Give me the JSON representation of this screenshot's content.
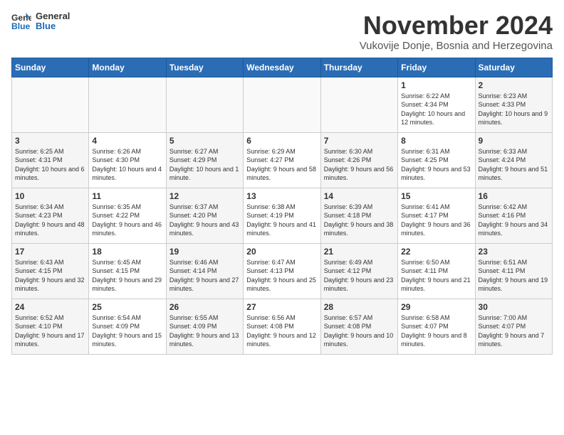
{
  "header": {
    "logo_line1": "General",
    "logo_line2": "Blue",
    "month_title": "November 2024",
    "subtitle": "Vukovije Donje, Bosnia and Herzegovina"
  },
  "weekdays": [
    "Sunday",
    "Monday",
    "Tuesday",
    "Wednesday",
    "Thursday",
    "Friday",
    "Saturday"
  ],
  "weeks": [
    [
      {
        "day": "",
        "text": ""
      },
      {
        "day": "",
        "text": ""
      },
      {
        "day": "",
        "text": ""
      },
      {
        "day": "",
        "text": ""
      },
      {
        "day": "",
        "text": ""
      },
      {
        "day": "1",
        "text": "Sunrise: 6:22 AM\nSunset: 4:34 PM\nDaylight: 10 hours and 12 minutes."
      },
      {
        "day": "2",
        "text": "Sunrise: 6:23 AM\nSunset: 4:33 PM\nDaylight: 10 hours and 9 minutes."
      }
    ],
    [
      {
        "day": "3",
        "text": "Sunrise: 6:25 AM\nSunset: 4:31 PM\nDaylight: 10 hours and 6 minutes."
      },
      {
        "day": "4",
        "text": "Sunrise: 6:26 AM\nSunset: 4:30 PM\nDaylight: 10 hours and 4 minutes."
      },
      {
        "day": "5",
        "text": "Sunrise: 6:27 AM\nSunset: 4:29 PM\nDaylight: 10 hours and 1 minute."
      },
      {
        "day": "6",
        "text": "Sunrise: 6:29 AM\nSunset: 4:27 PM\nDaylight: 9 hours and 58 minutes."
      },
      {
        "day": "7",
        "text": "Sunrise: 6:30 AM\nSunset: 4:26 PM\nDaylight: 9 hours and 56 minutes."
      },
      {
        "day": "8",
        "text": "Sunrise: 6:31 AM\nSunset: 4:25 PM\nDaylight: 9 hours and 53 minutes."
      },
      {
        "day": "9",
        "text": "Sunrise: 6:33 AM\nSunset: 4:24 PM\nDaylight: 9 hours and 51 minutes."
      }
    ],
    [
      {
        "day": "10",
        "text": "Sunrise: 6:34 AM\nSunset: 4:23 PM\nDaylight: 9 hours and 48 minutes."
      },
      {
        "day": "11",
        "text": "Sunrise: 6:35 AM\nSunset: 4:22 PM\nDaylight: 9 hours and 46 minutes."
      },
      {
        "day": "12",
        "text": "Sunrise: 6:37 AM\nSunset: 4:20 PM\nDaylight: 9 hours and 43 minutes."
      },
      {
        "day": "13",
        "text": "Sunrise: 6:38 AM\nSunset: 4:19 PM\nDaylight: 9 hours and 41 minutes."
      },
      {
        "day": "14",
        "text": "Sunrise: 6:39 AM\nSunset: 4:18 PM\nDaylight: 9 hours and 38 minutes."
      },
      {
        "day": "15",
        "text": "Sunrise: 6:41 AM\nSunset: 4:17 PM\nDaylight: 9 hours and 36 minutes."
      },
      {
        "day": "16",
        "text": "Sunrise: 6:42 AM\nSunset: 4:16 PM\nDaylight: 9 hours and 34 minutes."
      }
    ],
    [
      {
        "day": "17",
        "text": "Sunrise: 6:43 AM\nSunset: 4:15 PM\nDaylight: 9 hours and 32 minutes."
      },
      {
        "day": "18",
        "text": "Sunrise: 6:45 AM\nSunset: 4:15 PM\nDaylight: 9 hours and 29 minutes."
      },
      {
        "day": "19",
        "text": "Sunrise: 6:46 AM\nSunset: 4:14 PM\nDaylight: 9 hours and 27 minutes."
      },
      {
        "day": "20",
        "text": "Sunrise: 6:47 AM\nSunset: 4:13 PM\nDaylight: 9 hours and 25 minutes."
      },
      {
        "day": "21",
        "text": "Sunrise: 6:49 AM\nSunset: 4:12 PM\nDaylight: 9 hours and 23 minutes."
      },
      {
        "day": "22",
        "text": "Sunrise: 6:50 AM\nSunset: 4:11 PM\nDaylight: 9 hours and 21 minutes."
      },
      {
        "day": "23",
        "text": "Sunrise: 6:51 AM\nSunset: 4:11 PM\nDaylight: 9 hours and 19 minutes."
      }
    ],
    [
      {
        "day": "24",
        "text": "Sunrise: 6:52 AM\nSunset: 4:10 PM\nDaylight: 9 hours and 17 minutes."
      },
      {
        "day": "25",
        "text": "Sunrise: 6:54 AM\nSunset: 4:09 PM\nDaylight: 9 hours and 15 minutes."
      },
      {
        "day": "26",
        "text": "Sunrise: 6:55 AM\nSunset: 4:09 PM\nDaylight: 9 hours and 13 minutes."
      },
      {
        "day": "27",
        "text": "Sunrise: 6:56 AM\nSunset: 4:08 PM\nDaylight: 9 hours and 12 minutes."
      },
      {
        "day": "28",
        "text": "Sunrise: 6:57 AM\nSunset: 4:08 PM\nDaylight: 9 hours and 10 minutes."
      },
      {
        "day": "29",
        "text": "Sunrise: 6:58 AM\nSunset: 4:07 PM\nDaylight: 9 hours and 8 minutes."
      },
      {
        "day": "30",
        "text": "Sunrise: 7:00 AM\nSunset: 4:07 PM\nDaylight: 9 hours and 7 minutes."
      }
    ]
  ]
}
